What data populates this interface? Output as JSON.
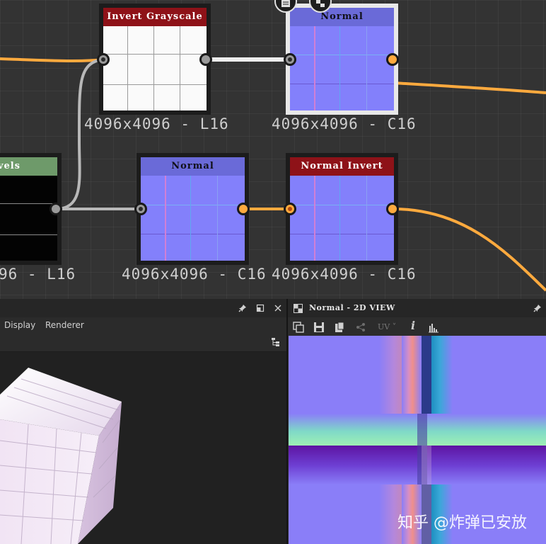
{
  "graph": {
    "nodes": [
      {
        "id": "invert-grayscale",
        "title": "Invert Grayscale",
        "info": "4096x4096 - L16"
      },
      {
        "id": "normal-top",
        "title": "Normal",
        "info": "4096x4096 - C16"
      },
      {
        "id": "levels",
        "title": "vels",
        "info": "96 - L16"
      },
      {
        "id": "normal-mid",
        "title": "Normal",
        "info": "4096x4096 - C16"
      },
      {
        "id": "normal-invert",
        "title": "Normal Invert",
        "info": "4096x4096 - C16"
      }
    ],
    "colors": {
      "wire_orange": "#ffaa3e",
      "wire_gray": "#b8b8b8",
      "title_red": "#8e1218",
      "title_blue": "#6a6ad8",
      "title_green": "#6e9a6a",
      "normal_map": "#8380fb"
    }
  },
  "view3d": {
    "menu": [
      "Display",
      "Renderer"
    ],
    "icons": [
      "pin-icon",
      "float-icon",
      "close-icon",
      "scene-tree-icon"
    ]
  },
  "view2d": {
    "title": "Normal - 2D VIEW",
    "uv_label": "UV",
    "icons": [
      "pin-icon",
      "copy-icon",
      "save-icon",
      "clipboard-icon",
      "share-icon",
      "info-icon",
      "histogram-icon"
    ]
  },
  "watermark": "知乎 @炸弹已安放"
}
